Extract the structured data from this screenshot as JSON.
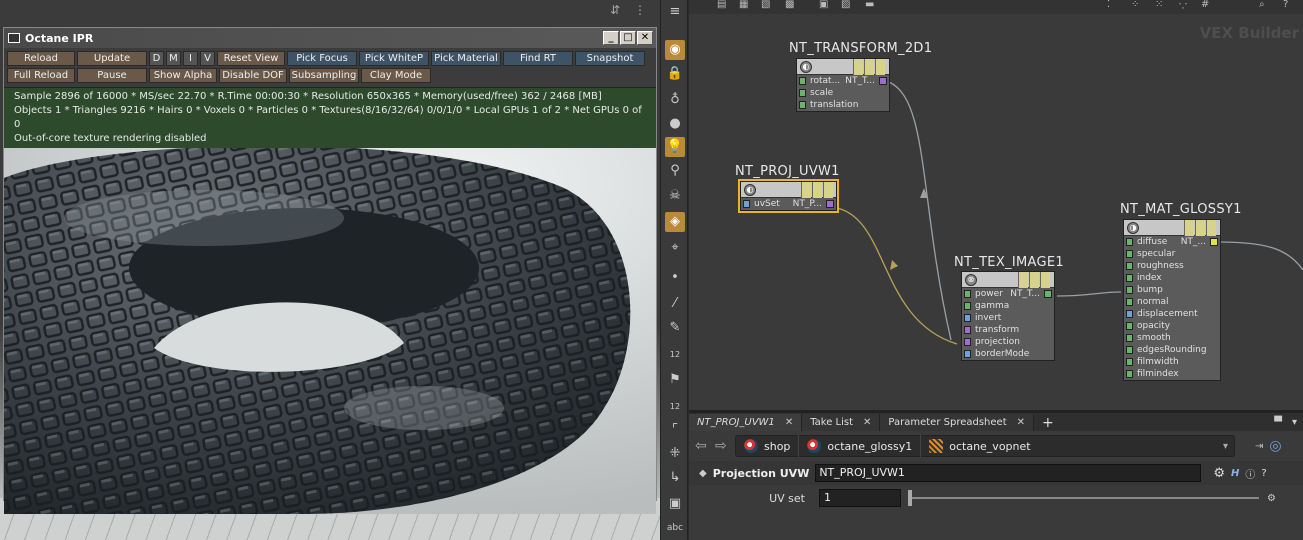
{
  "ipr": {
    "title": "Octane IPR",
    "toolbar_row1": [
      "Reload",
      "Update",
      "D",
      "M",
      "I",
      "V",
      "Reset View",
      "Pick Focus",
      "Pick WhiteP",
      "Pick Material",
      "Find RT",
      "Snapshot"
    ],
    "toolbar_row2": [
      "Full Reload",
      "Pause",
      "Show Alpha",
      "Disable DOF",
      "Subsampling",
      "Clay Mode"
    ],
    "status": [
      "Sample 2896 of 16000 * MS/sec 22.70 * R.Time 00:00:30 * Resolution 650x365 * Memory(used/free) 362 / 2468 [MB]",
      "Objects 1 * Triangles 9216 * Hairs 0 * Voxels 0 * Particles 0 * Textures(8/16/32/64) 0/0/1/0 * Local GPUs 1 of 2 * Net GPUs 0 of 0",
      "Out-of-core texture rendering disabled"
    ]
  },
  "network": {
    "background_label": "VEX Builder",
    "nodes": [
      {
        "title": "NT_TRANSFORM_2D1",
        "inputs": [
          "rotat...",
          "scale",
          "translation"
        ],
        "output": "NT_T..."
      },
      {
        "title": "NT_PROJ_UVW1",
        "inputs": [
          "uvSet"
        ],
        "output": "NT_P..."
      },
      {
        "title": "NT_TEX_IMAGE1",
        "inputs": [
          "power",
          "gamma",
          "invert",
          "transform",
          "projection",
          "borderMode"
        ],
        "output": "NT_T..."
      },
      {
        "title": "NT_MAT_GLOSSY1",
        "inputs": [
          "diffuse",
          "specular",
          "roughness",
          "index",
          "bump",
          "normal",
          "displacement",
          "opacity",
          "smooth",
          "edgesRounding",
          "filmwidth",
          "filmindex"
        ],
        "output": "NT_..."
      }
    ]
  },
  "tabs": [
    "NT_PROJ_UVW1",
    "Take List",
    "Parameter Spreadsheet"
  ],
  "breadcrumbs": [
    "shop",
    "octane_glossy1",
    "octane_vopnet"
  ],
  "params": {
    "type_label": "Projection UVW",
    "node_name": "NT_PROJ_UVW1",
    "uvset_label": "UV set",
    "uvset_value": "1"
  },
  "side_labels": {
    "num1": "12",
    "num2": "12",
    "abc": "abc"
  },
  "colors": {
    "accent": "#e8b52a",
    "wire": "#b8a058",
    "status_bg": "#2d4a2d"
  }
}
